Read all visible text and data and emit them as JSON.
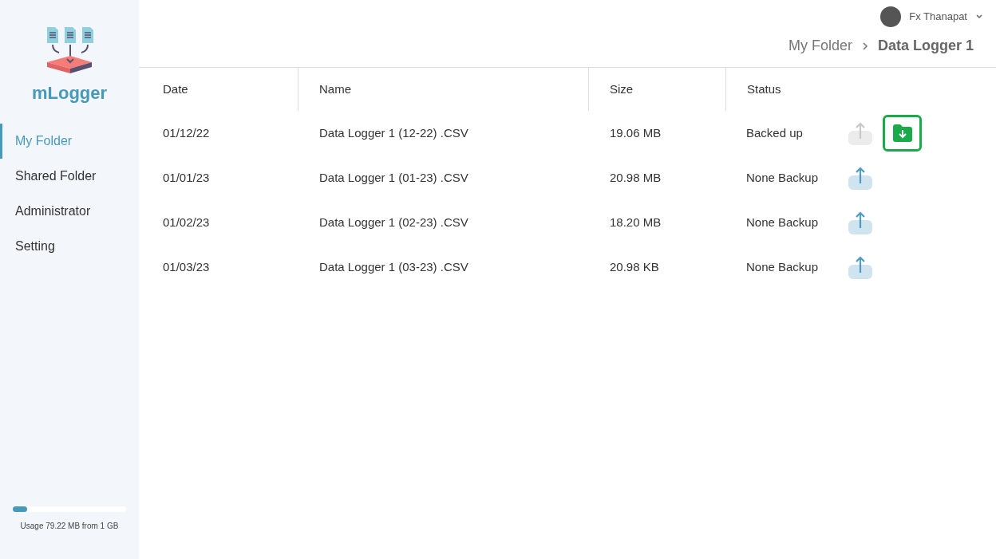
{
  "app": {
    "name": "mLogger"
  },
  "sidebar": {
    "items": [
      {
        "label": "My Folder",
        "selected": true
      },
      {
        "label": "Shared Folder",
        "selected": false
      },
      {
        "label": "Administrator",
        "selected": false
      },
      {
        "label": "Setting",
        "selected": false
      }
    ]
  },
  "usage": {
    "level": 0.13,
    "text": "Usage 79.22 MB from 1 GB"
  },
  "user": {
    "name": "Fx Thanapat"
  },
  "breadcrumb": [
    "My Folder",
    "Data Logger 1"
  ],
  "table": {
    "columns": [
      "Date",
      "Name",
      "Size",
      "Status"
    ],
    "rows": [
      {
        "date": "01/12/22",
        "name": "Data Logger 1 (12-22) .CSV",
        "size": "19.06 MB",
        "status": "Backed up",
        "upload_disabled": true,
        "download_available": true
      },
      {
        "date": "01/01/23",
        "name": "Data Logger 1 (01-23) .CSV",
        "size": "20.98 MB",
        "status": "None Backup",
        "upload_disabled": false,
        "download_available": false
      },
      {
        "date": "01/02/23",
        "name": "Data Logger 1 (02-23) .CSV",
        "size": "18.20 MB",
        "status": "None Backup",
        "upload_disabled": false,
        "download_available": false
      },
      {
        "date": "01/03/23",
        "name": "Data Logger 1 (03-23) .CSV",
        "size": "20.98 KB",
        "status": "None Backup",
        "upload_disabled": false,
        "download_available": false
      }
    ]
  }
}
